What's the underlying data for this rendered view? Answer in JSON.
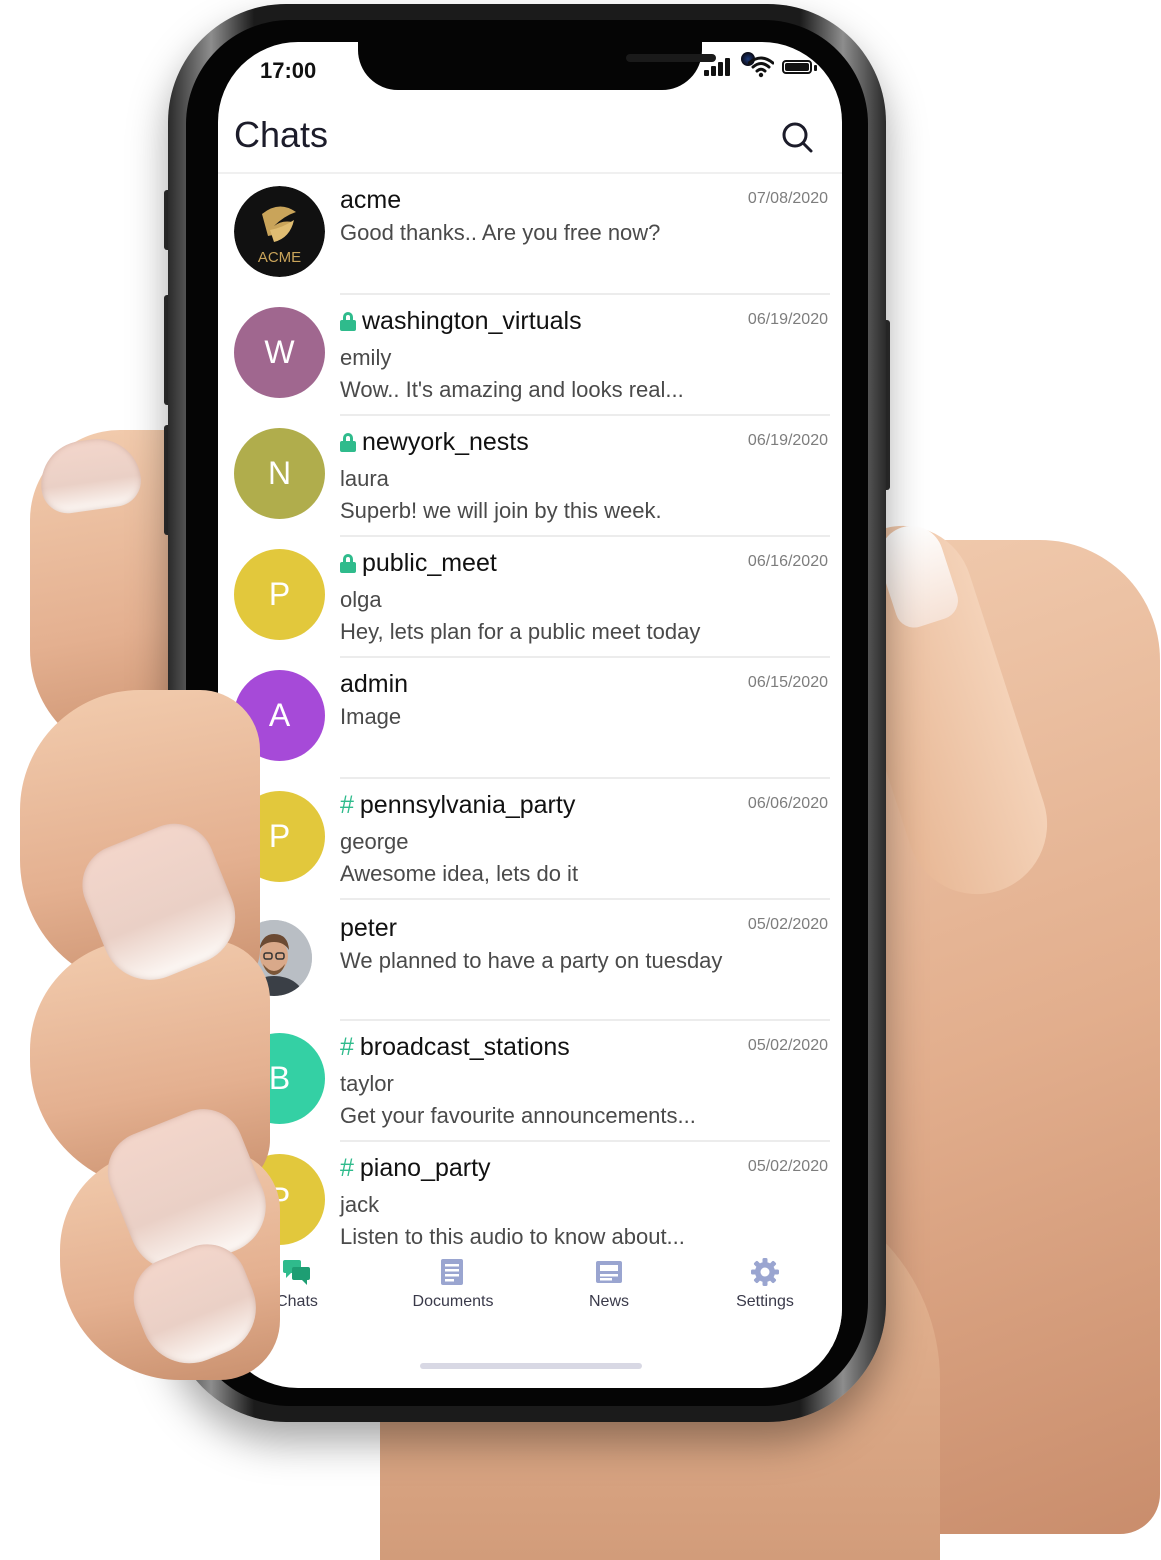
{
  "status_bar": {
    "time": "17:00"
  },
  "header": {
    "title": "Chats"
  },
  "chats": [
    {
      "name": "acme",
      "sender": "",
      "message": "Good thanks.. Are you free now?",
      "date": "07/08/2020",
      "avatar_text": "ACME",
      "avatar_color": "#111111",
      "prefix": "none"
    },
    {
      "name": "washington_virtuals",
      "sender": "emily",
      "message": "Wow.. It's amazing and looks real...",
      "date": "06/19/2020",
      "avatar_text": "W",
      "avatar_color": "#a0678f",
      "prefix": "lock"
    },
    {
      "name": "newyork_nests",
      "sender": "laura",
      "message": "Superb! we will join by this week.",
      "date": "06/19/2020",
      "avatar_text": "N",
      "avatar_color": "#b0ad4c",
      "prefix": "lock"
    },
    {
      "name": "public_meet",
      "sender": "olga",
      "message": "Hey, lets plan for a public meet today",
      "date": "06/16/2020",
      "avatar_text": "P",
      "avatar_color": "#e2c83c",
      "prefix": "lock"
    },
    {
      "name": "admin",
      "sender": "",
      "message": "Image",
      "date": "06/15/2020",
      "avatar_text": "A",
      "avatar_color": "#a64ad8",
      "prefix": "none"
    },
    {
      "name": "pennsylvania_party",
      "sender": "george",
      "message": "Awesome idea, lets do it",
      "date": "06/06/2020",
      "avatar_text": "P",
      "avatar_color": "#e2c83c",
      "prefix": "hash"
    },
    {
      "name": "peter",
      "sender": "",
      "message": "We planned to have a party on tuesday",
      "date": "05/02/2020",
      "avatar_text": "",
      "avatar_color": "#cfd3d8",
      "prefix": "none"
    },
    {
      "name": "broadcast_stations",
      "sender": "taylor",
      "message": "Get your favourite announcements...",
      "date": "05/02/2020",
      "avatar_text": "B",
      "avatar_color": "#34d0a4",
      "prefix": "hash"
    },
    {
      "name": "piano_party",
      "sender": "jack",
      "message": "Listen to this audio to know about...",
      "date": "05/02/2020",
      "avatar_text": "P",
      "avatar_color": "#e2c83c",
      "prefix": "hash"
    }
  ],
  "bottom_nav": [
    {
      "label": "Chats",
      "icon": "chats-icon",
      "active": true
    },
    {
      "label": "Documents",
      "icon": "documents-icon",
      "active": false
    },
    {
      "label": "News",
      "icon": "news-icon",
      "active": false
    },
    {
      "label": "Settings",
      "icon": "settings-icon",
      "active": false
    }
  ],
  "colors": {
    "accent": "#2fbb8c",
    "nav_icon": "#8a96c4"
  }
}
